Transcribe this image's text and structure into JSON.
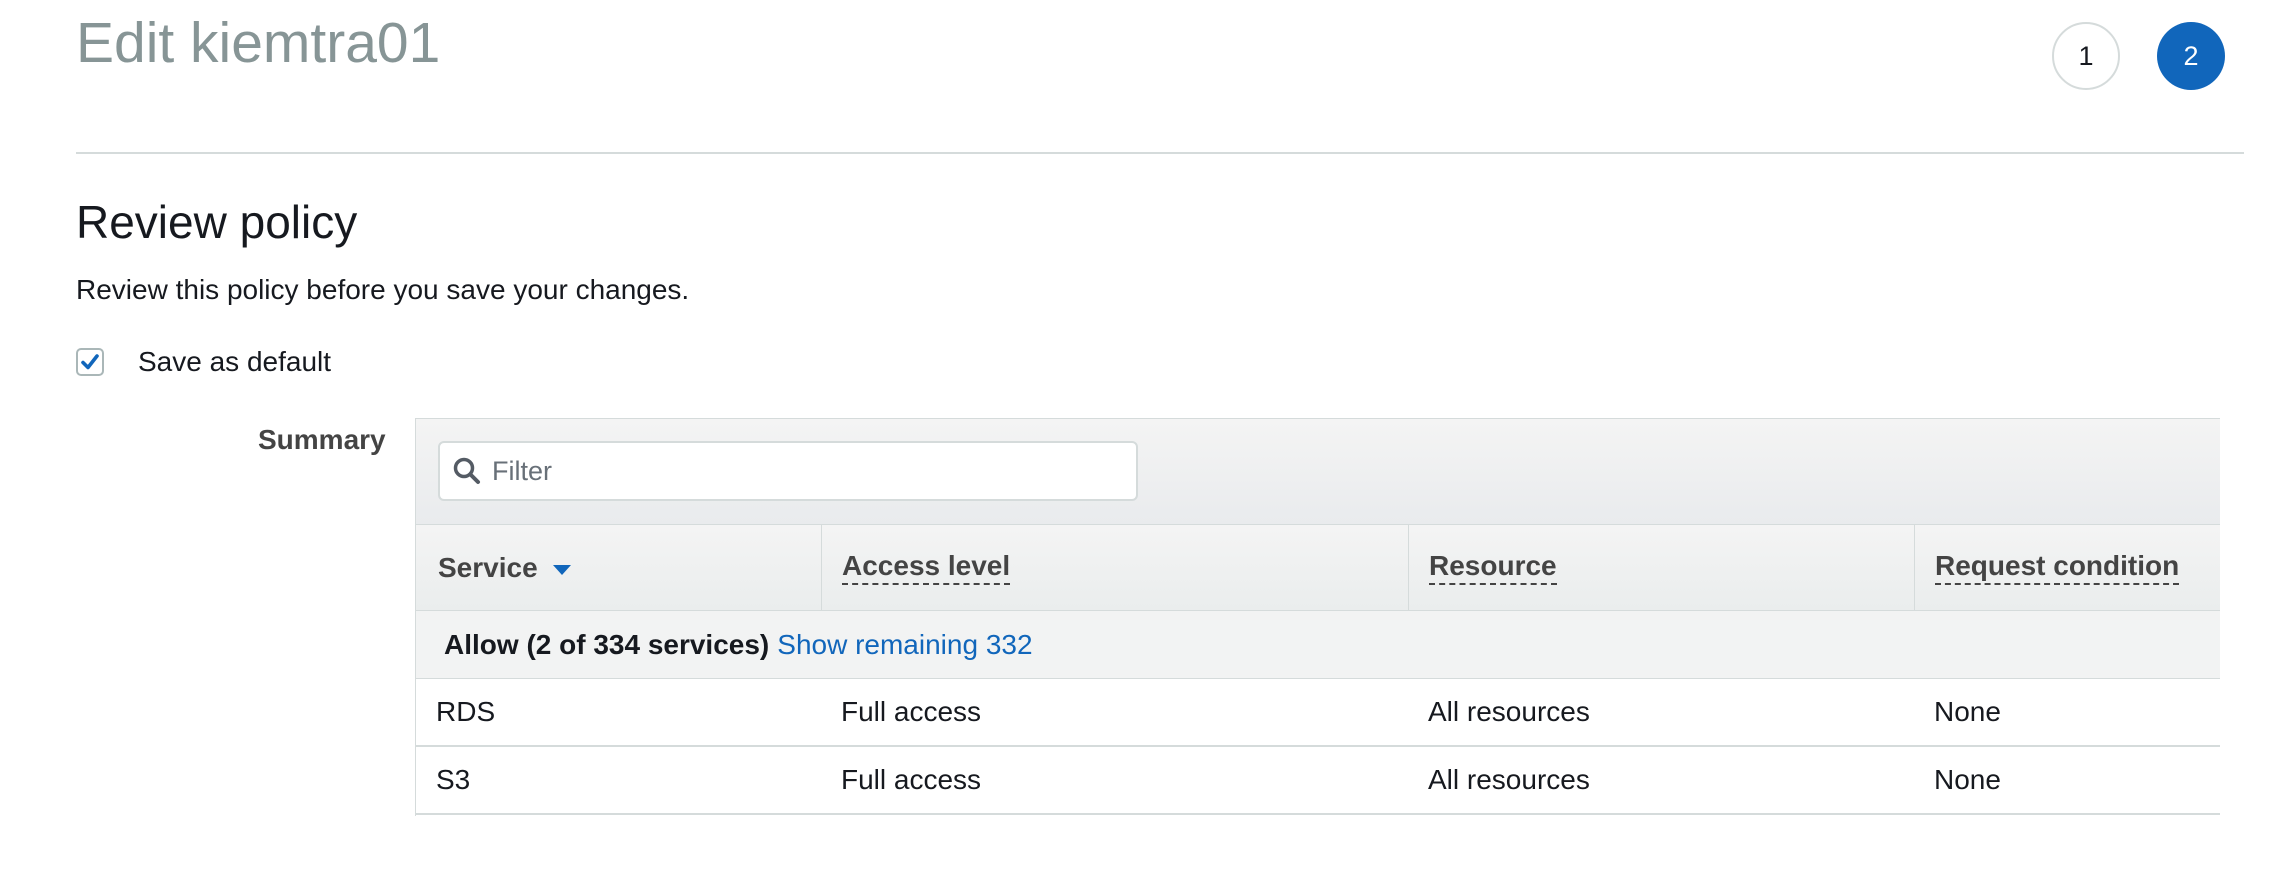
{
  "header": {
    "title": "Edit kiemtra01",
    "steps": [
      {
        "label": "1",
        "active": false
      },
      {
        "label": "2",
        "active": true
      }
    ]
  },
  "review": {
    "title": "Review policy",
    "description": "Review this policy before you save your changes.",
    "save_default": {
      "label": "Save as default",
      "checked": true
    }
  },
  "summary": {
    "label": "Summary",
    "filter": {
      "placeholder": "Filter",
      "value": ""
    },
    "columns": [
      "Service",
      "Access level",
      "Resource",
      "Request condition"
    ],
    "sort_icon": "caret-down-icon",
    "group": {
      "title": "Allow (2 of 334 services)",
      "link": "Show remaining 332"
    },
    "rows": [
      {
        "service": "RDS",
        "access_level": "Full access",
        "resource": "All resources",
        "request_condition": "None"
      },
      {
        "service": "S3",
        "access_level": "Full access",
        "resource": "All resources",
        "request_condition": "None"
      }
    ]
  },
  "colors": {
    "accent": "#1166bb",
    "title_gray": "#879596",
    "border": "#d5dbdb"
  }
}
